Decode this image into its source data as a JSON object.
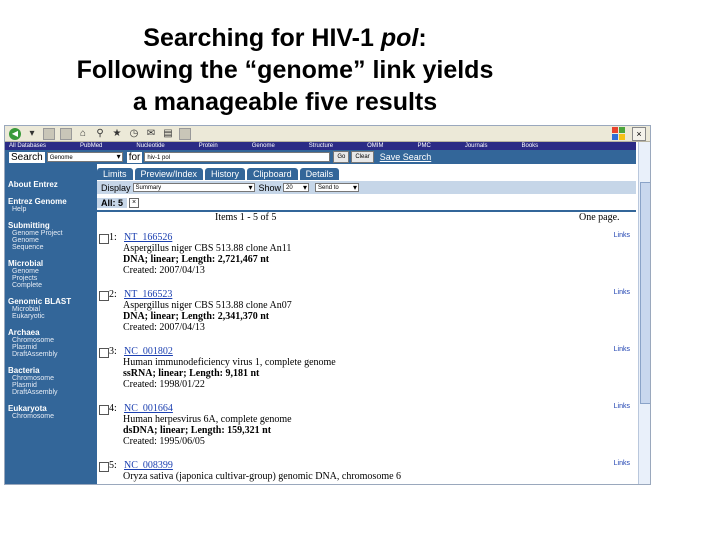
{
  "slide": {
    "title_line1": "Searching for HIV-1 ",
    "title_line1_italic": "pol",
    "title_line1_end": ":",
    "title_line2": "Following the “genome” link yields",
    "title_line3": "a manageable five results"
  },
  "browser": {
    "close_glyph": "×"
  },
  "dbbar": [
    "All Databases",
    "PubMed",
    "Nucleotide",
    "Protein",
    "Genome",
    "Structure",
    "OMIM",
    "PMC",
    "Journals",
    "Books"
  ],
  "search": {
    "label": "Search",
    "db_value": "Genome",
    "for_label": "for",
    "query": "hiv-1 pol",
    "go_label": "Go",
    "clear_label": "Clear",
    "save_label": "Save Search"
  },
  "sidebar": [
    {
      "head": "About Entrez",
      "subs": []
    },
    {
      "head": "Entrez Genome",
      "subs": [
        "Help"
      ]
    },
    {
      "head": "Submitting",
      "subs": [
        "Genome Project",
        "Genome",
        "Sequence"
      ]
    },
    {
      "head": "Microbial",
      "subs": [
        "Genome",
        "Projects",
        "Complete"
      ]
    },
    {
      "head": "Genomic BLAST",
      "subs": [
        "Microbial",
        "Eukaryotic"
      ]
    },
    {
      "head": "Archaea",
      "subs": [
        "Chromosome",
        "Plasmid",
        "DraftAssembly"
      ]
    },
    {
      "head": "Bacteria",
      "subs": [
        "Chromosome",
        "Plasmid",
        "DraftAssembly"
      ]
    },
    {
      "head": "Eukaryota",
      "subs": [
        "Chromosome"
      ]
    }
  ],
  "tabs": [
    "Limits",
    "Preview/Index",
    "History",
    "Clipboard",
    "Details"
  ],
  "display": {
    "label": "Display",
    "value": "Summary",
    "show_label": "Show",
    "show_value": "20",
    "send_value": "Send to"
  },
  "all_tab": {
    "label": "All: 5",
    "x": "×"
  },
  "items_text": "Items 1 - 5 of 5",
  "one_page": "One page.",
  "results": [
    {
      "num": "1:",
      "acc": "NT_166526",
      "lines": [
        "Aspergillus niger CBS 513.88 clone An11"
      ],
      "bold": "DNA; linear; Length: 2,721,467 nt",
      "created": "Created: 2007/04/13",
      "links": "Links"
    },
    {
      "num": "2:",
      "acc": "NT_166523",
      "lines": [
        "Aspergillus niger CBS 513.88 clone An07"
      ],
      "bold": "DNA; linear; Length: 2,341,370 nt",
      "created": "Created: 2007/04/13",
      "links": "Links"
    },
    {
      "num": "3:",
      "acc": "NC_001802",
      "lines": [
        "Human immunodeficiency virus 1, complete genome"
      ],
      "bold": "ssRNA; linear; Length: 9,181 nt",
      "created": "Created: 1998/01/22",
      "links": "Links"
    },
    {
      "num": "4:",
      "acc": "NC_001664",
      "lines": [
        "Human herpesvirus 6A, complete genome"
      ],
      "bold": "dsDNA; linear; Length: 159,321 nt",
      "created": "Created: 1995/06/05",
      "links": "Links"
    },
    {
      "num": "5:",
      "acc": "NC_008399",
      "lines": [
        "Oryza sativa (japonica cultivar-group) genomic DNA, chromosome 6"
      ],
      "bold": "",
      "created": "",
      "links": "Links"
    }
  ]
}
